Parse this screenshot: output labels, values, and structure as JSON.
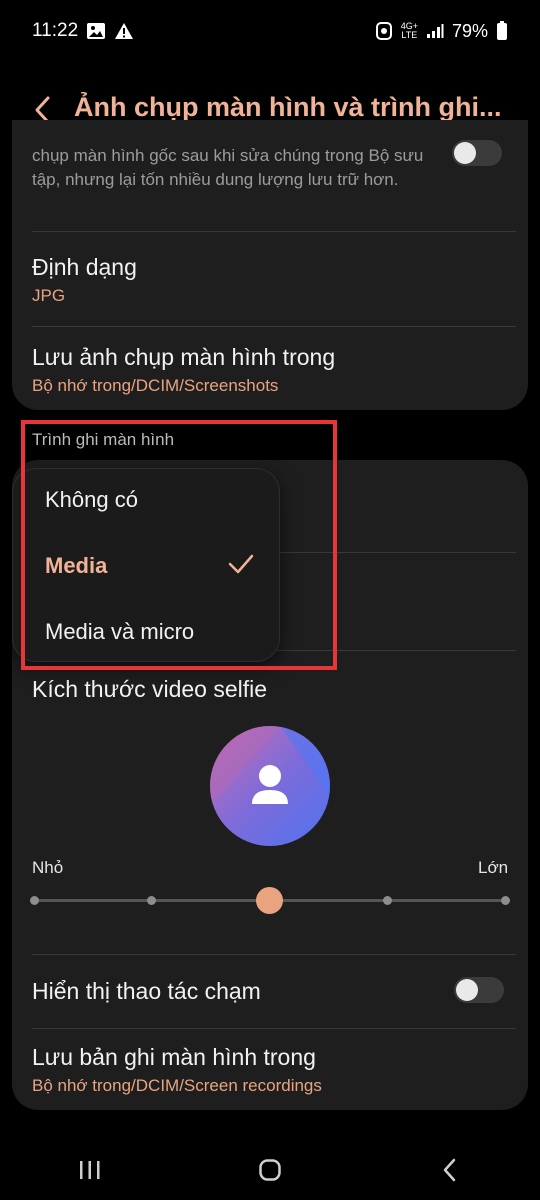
{
  "status_bar": {
    "time": "11:22",
    "network_label_top": "4G+",
    "network_label_bottom": "LTE",
    "battery": "79%"
  },
  "header": {
    "title": "Ảnh chụp màn hình và trình ghi..."
  },
  "screenshots": {
    "keep_original_desc": "chụp màn hình gốc sau khi sửa chúng trong Bộ sưu tập, nhưng lại tốn nhiều dung lượng lưu trữ hơn.",
    "keep_original_toggle": "off",
    "format_label": "Định dạng",
    "format_value": "JPG",
    "save_location_label": "Lưu ảnh chụp màn hình trong",
    "save_location_value": "Bộ nhớ trong/DCIM/Screenshots"
  },
  "recorder": {
    "section_header": "Trình ghi màn hình",
    "sound_options": [
      "Không có",
      "Media",
      "Media và micro"
    ],
    "sound_selected": "Media",
    "selfie_size_label": "Kích thước video selfie",
    "slider_min_label": "Nhỏ",
    "slider_max_label": "Lớn",
    "slider_steps": 5,
    "slider_value_index": 2,
    "show_touches_label": "Hiển thị thao tác chạm",
    "show_touches_toggle": "off",
    "save_recordings_label": "Lưu bản ghi màn hình trong",
    "save_recordings_value": "Bộ nhớ trong/DCIM/Screen recordings"
  },
  "icons": {
    "back": "chevron-left-icon",
    "check": "check-icon",
    "avatar": "person-icon",
    "nav_recent": "recent-apps-icon",
    "nav_home": "home-icon",
    "nav_back": "back-icon"
  },
  "colors": {
    "accent": "#f0b397",
    "accent_secondary": "#e9a47f",
    "card_bg": "#1f1e1f",
    "highlight": "#e7353a"
  }
}
